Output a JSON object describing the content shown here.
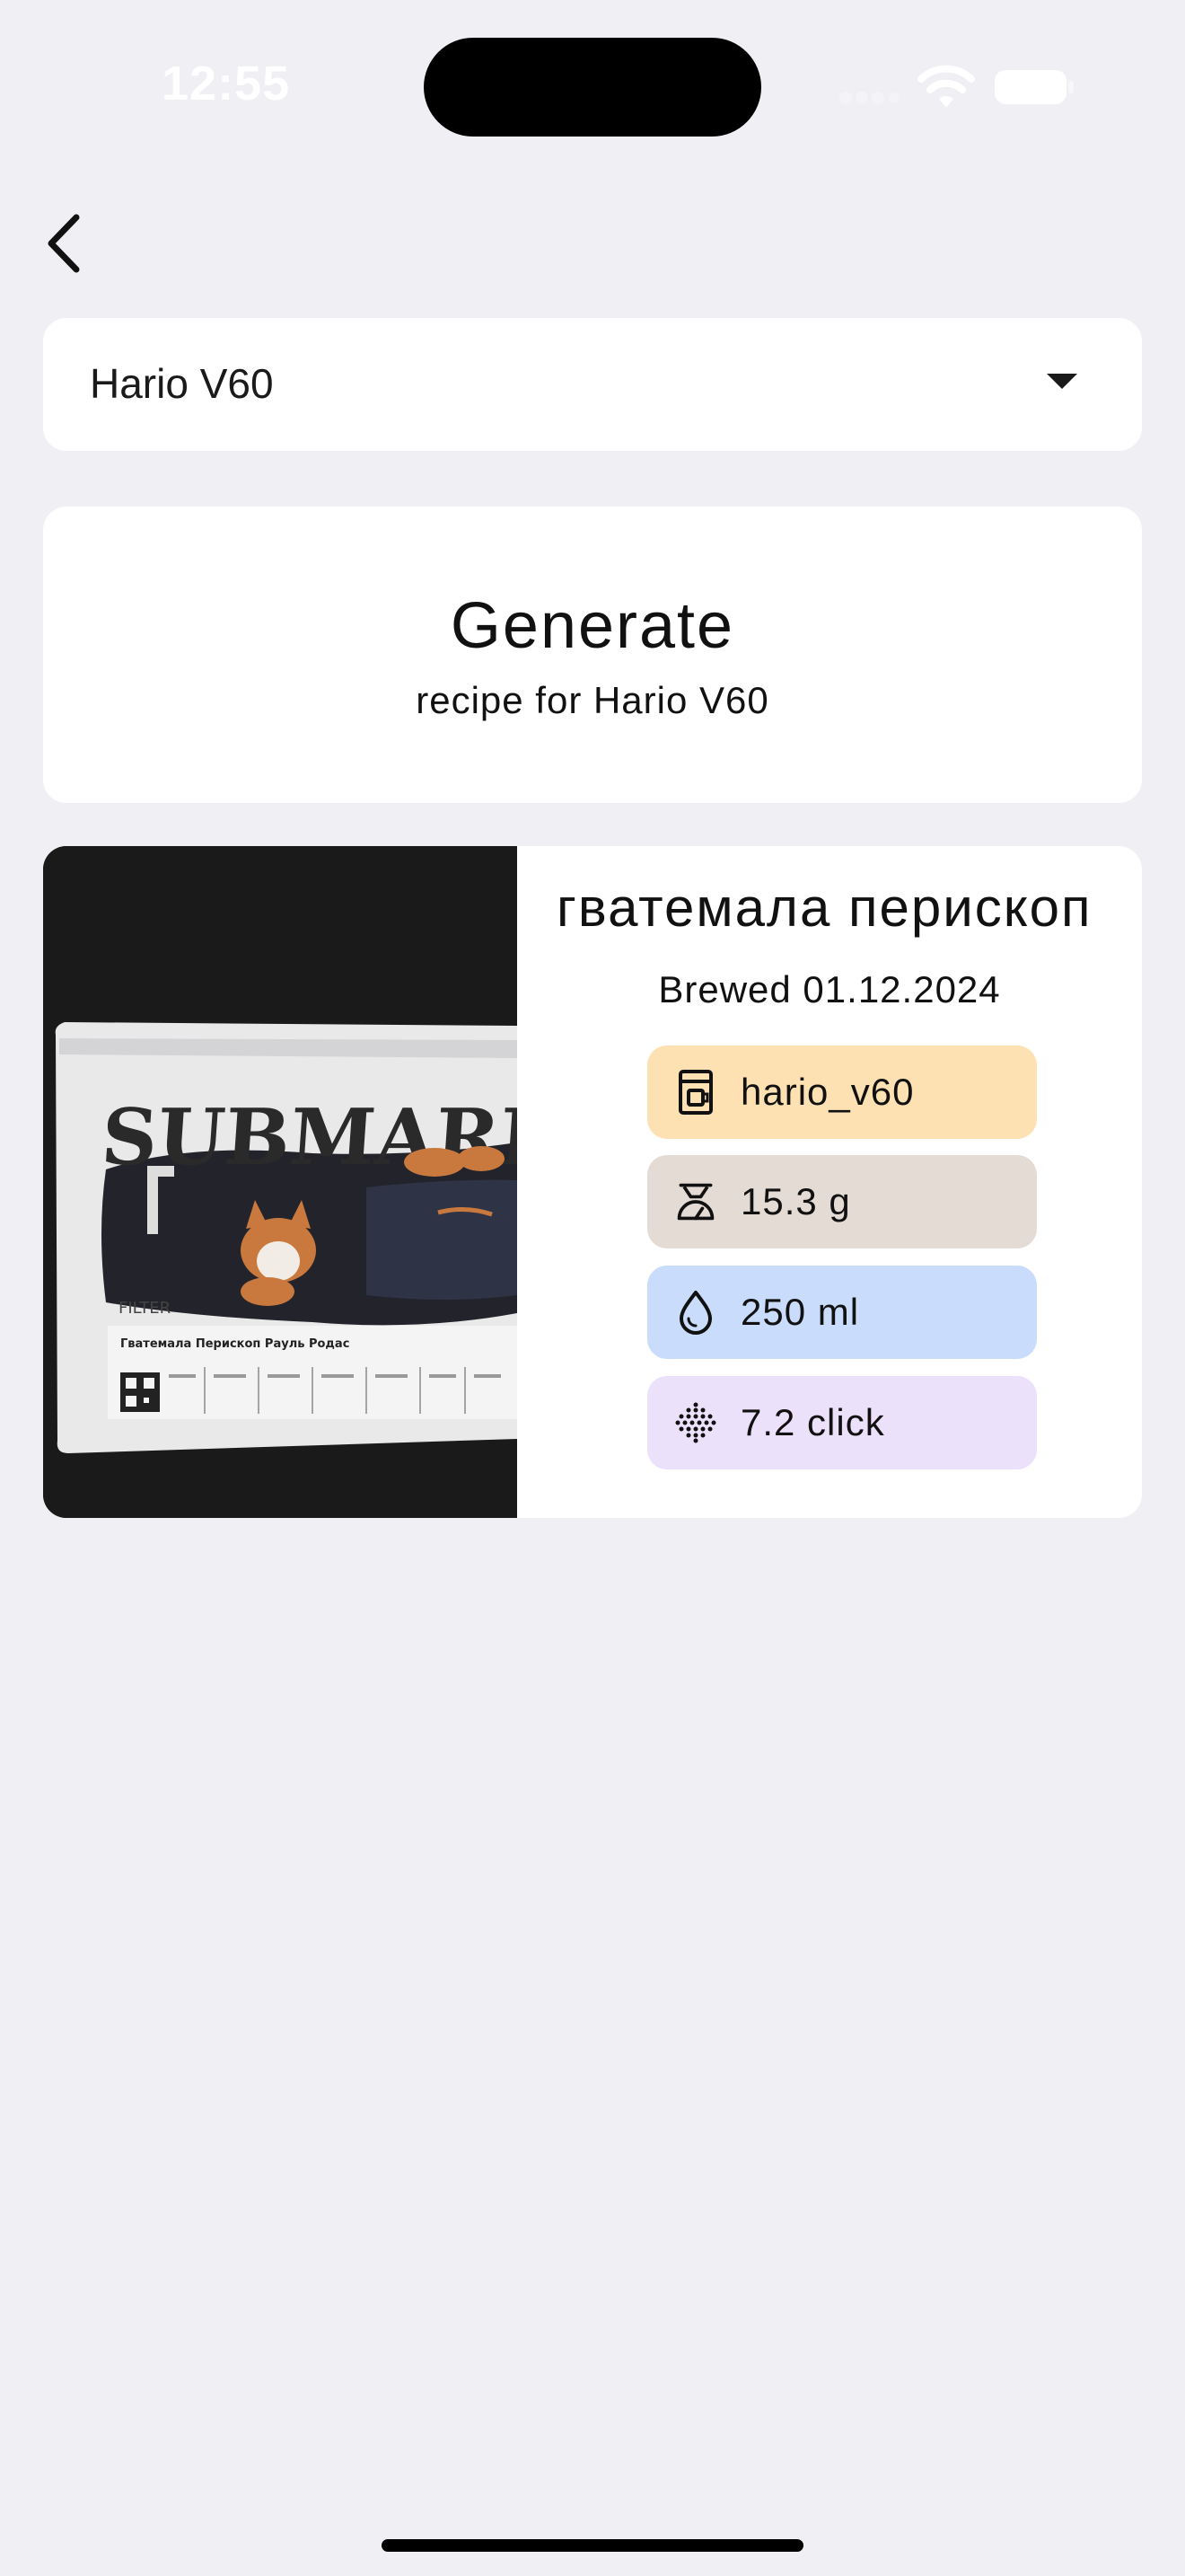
{
  "status_bar": {
    "time": "12:55"
  },
  "brewer_select": {
    "selected": "Hario V60"
  },
  "generate": {
    "title": "Generate",
    "subtitle": "recipe for Hario V60"
  },
  "recipe": {
    "title": "гватемала перископ",
    "brewed": "Brewed 01.12.2024",
    "photo": {
      "brand": "SUBMARINE",
      "type": "FILTER",
      "coffee_name": "Гватемала Перископ Рауль Родас"
    },
    "chips": {
      "method": "hario_v60",
      "dose": "15.3 g",
      "water": "250 ml",
      "grind": "7.2 click"
    }
  },
  "colors": {
    "background": "#efeff4",
    "card": "#ffffff",
    "chip_method": "#fde1b3",
    "chip_dose": "#e5dbd5",
    "chip_water": "#c9dcfb",
    "chip_grind": "#ece1fb"
  },
  "icons": {
    "back": "chevron-left-icon",
    "dropdown": "caret-down-icon",
    "method": "coffee-maker-icon",
    "dose": "scale-icon",
    "water": "water-drop-icon",
    "grind": "grinder-dots-icon"
  }
}
